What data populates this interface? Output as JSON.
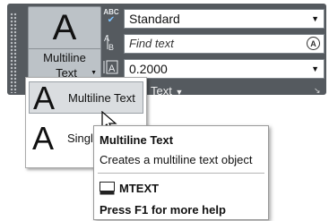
{
  "ribbon": {
    "big_button": {
      "glyph": "A",
      "label_line1": "Multiline",
      "label_line2": "Text",
      "caret": "▼"
    },
    "rows": [
      {
        "icon": "text-style-icon",
        "icon_text": "ABC",
        "value": "Standard",
        "dropdown": "▼"
      },
      {
        "icon": "find-text-icon",
        "icon_text": "A B",
        "placeholder": "Find text",
        "search_glyph": "A"
      },
      {
        "icon": "text-height-icon",
        "icon_text": "A",
        "value": "0.2000",
        "dropdown": "▼"
      }
    ],
    "panel_title": "Text",
    "panel_title_caret": "▼",
    "dialog_launcher": "↘"
  },
  "menu": {
    "items": [
      {
        "glyph": "A",
        "label": "Multiline Text",
        "active": true
      },
      {
        "glyph": "A",
        "label": "Singl",
        "active": false
      }
    ]
  },
  "tooltip": {
    "title": "Multiline Text",
    "description": "Creates a multiline text object",
    "command": "MTEXT",
    "help": "Press F1 for more help"
  },
  "colors": {
    "ribbon_bg": "#555a5f",
    "button_bg": "#bcc2c7",
    "menu_active_bg": "#dadde0"
  }
}
